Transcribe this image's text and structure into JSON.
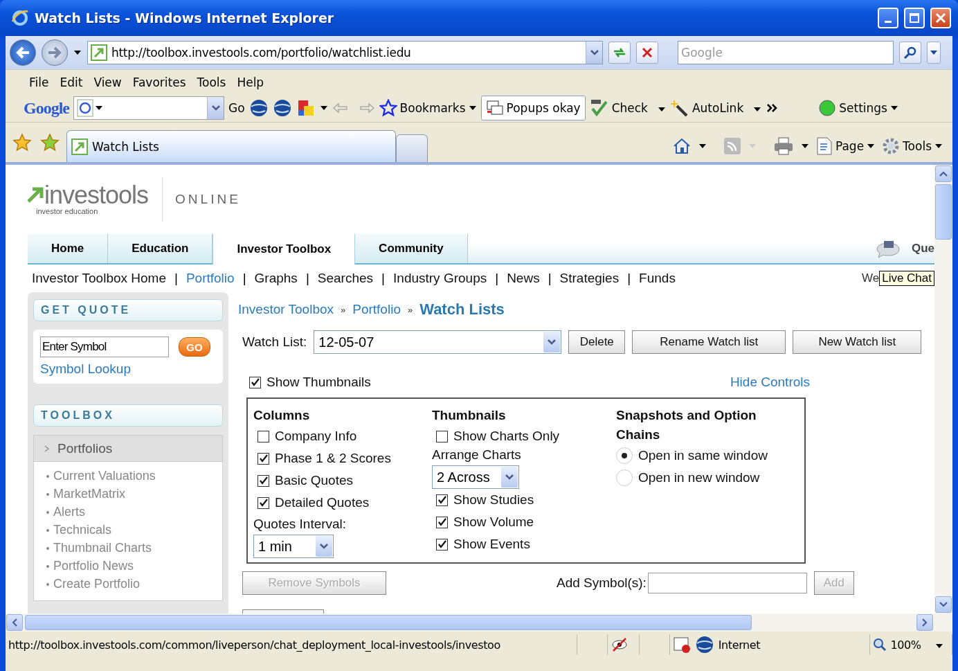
{
  "window": {
    "title": "Watch Lists - Windows Internet Explorer"
  },
  "address_bar": {
    "url": "http://toolbox.investools.com/portfolio/watchlist.iedu",
    "search_placeholder": "Google"
  },
  "menu": [
    "File",
    "Edit",
    "View",
    "Favorites",
    "Tools",
    "Help"
  ],
  "google_toolbar": {
    "logo": "Google",
    "go": "Go",
    "bookmarks": "Bookmarks",
    "popups": "Popups okay",
    "check": "Check",
    "autolink": "AutoLink",
    "settings": "Settings"
  },
  "browser_tab": {
    "title": "Watch Lists"
  },
  "command_bar": {
    "page": "Page",
    "tools": "Tools"
  },
  "subnav_separator": "|",
  "breadcrumb_separator": "»",
  "site": {
    "logo": "investools",
    "logo_sub": "investor education",
    "online": "ONLINE",
    "nav_extra": "Que",
    "welcome": "We",
    "tooltip": "Live Chat"
  },
  "nav_tabs": [
    {
      "label": "Home",
      "selected": false
    },
    {
      "label": "Education",
      "selected": false
    },
    {
      "label": "Investor Toolbox",
      "selected": true
    },
    {
      "label": "Community",
      "selected": false
    }
  ],
  "subnav": [
    {
      "label": "Investor Toolbox Home",
      "selected": false
    },
    {
      "label": "Portfolio",
      "selected": true
    },
    {
      "label": "Graphs",
      "selected": false
    },
    {
      "label": "Searches",
      "selected": false
    },
    {
      "label": "Industry Groups",
      "selected": false
    },
    {
      "label": "News",
      "selected": false
    },
    {
      "label": "Strategies",
      "selected": false
    },
    {
      "label": "Funds",
      "selected": false
    }
  ],
  "sidebar": {
    "quote_title": "GET QUOTE",
    "symbol_value": "Enter Symbol",
    "go": "GO",
    "lookup": "Symbol Lookup",
    "toolbox_title": "TOOLBOX",
    "section": "Portfolios",
    "items": [
      "Current Valuations",
      "MarketMatrix",
      "Alerts",
      "Technicals",
      "Thumbnail Charts",
      "Portfolio News",
      "Create Portfolio"
    ]
  },
  "breadcrumb": [
    "Investor Toolbox",
    "Portfolio"
  ],
  "page_title": "Watch Lists",
  "watch_list": {
    "label": "Watch List:",
    "value": "12-05-07",
    "buttons": [
      "Delete",
      "Rename Watch list",
      "New Watch list"
    ]
  },
  "show_thumbnails": {
    "label": "Show Thumbnails",
    "checked": true
  },
  "hide_controls": "Hide Controls",
  "columns": {
    "heading": "Columns",
    "options": [
      {
        "label": "Company Info",
        "checked": false
      },
      {
        "label": "Phase 1 & 2 Scores",
        "checked": true
      },
      {
        "label": "Basic Quotes",
        "checked": true
      },
      {
        "label": "Detailed Quotes",
        "checked": true
      }
    ],
    "interval_label": "Quotes Interval:",
    "interval_value": "1 min"
  },
  "thumbnails": {
    "heading": "Thumbnails",
    "charts_only": {
      "label": "Show Charts Only",
      "checked": false
    },
    "arrange_label": "Arrange Charts",
    "arrange_value": "2 Across",
    "options": [
      {
        "label": "Show Studies",
        "checked": true
      },
      {
        "label": "Show Volume",
        "checked": true
      },
      {
        "label": "Show Events",
        "checked": true
      }
    ]
  },
  "snapshots": {
    "heading": "Snapshots and Option Chains",
    "options": [
      {
        "label": "Open in same window",
        "selected": true
      },
      {
        "label": "Open in new window",
        "selected": false
      }
    ]
  },
  "remove_button": {
    "label": "Remove Symbols",
    "disabled": true
  },
  "add_label": "Add Symbol(s):",
  "add_button": {
    "label": "Add",
    "disabled": true
  },
  "status_bar": {
    "url": "http://toolbox.investools.com/common/liveperson/chat_deployment_local-investools/investoo",
    "zone": "Internet",
    "zoom": "100%"
  }
}
